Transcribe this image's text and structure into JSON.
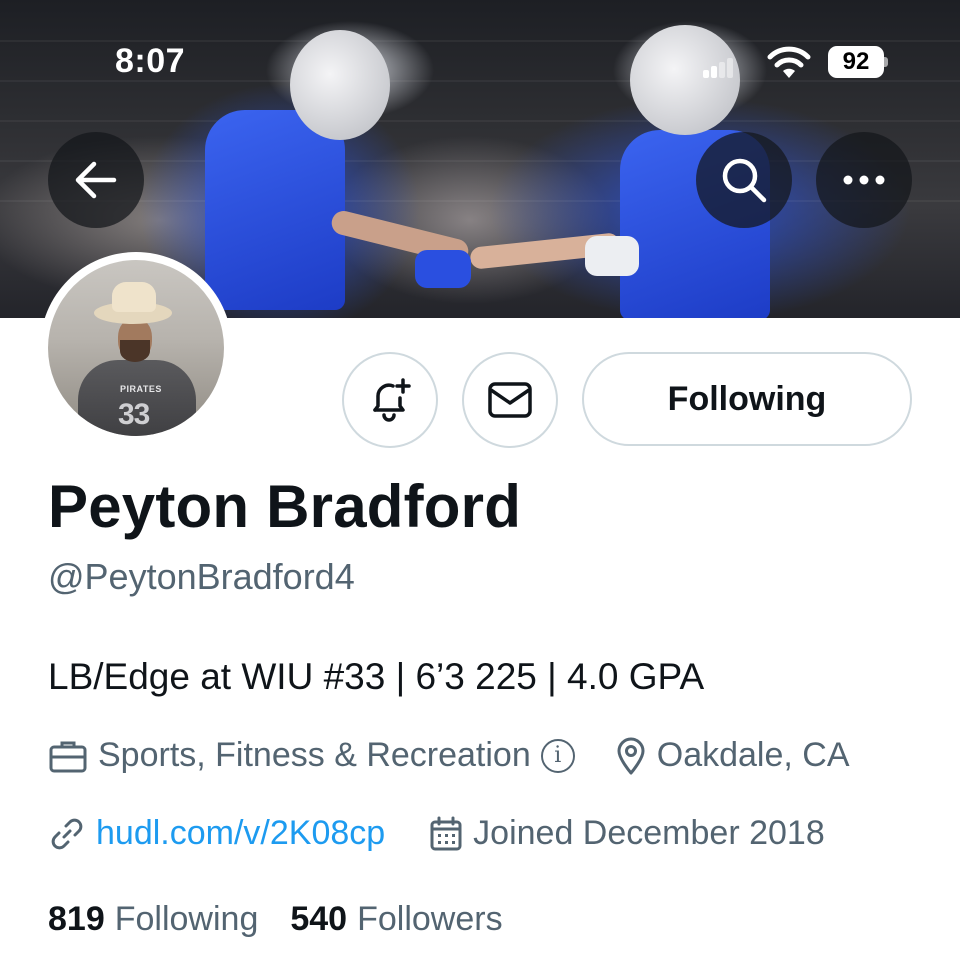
{
  "status_bar": {
    "time": "8:07",
    "battery": "92",
    "icons": [
      "cellular-signal-icon",
      "wifi-icon",
      "battery-icon"
    ]
  },
  "nav": {
    "back_icon": "arrow-left-icon",
    "search_icon": "search-icon",
    "more_icon": "more-horizontal-icon"
  },
  "profile": {
    "name": "Peyton Bradford",
    "handle": "@PeytonBradford4",
    "bio": "LB/Edge at WIU #33 | 6’3 225 | 4.0 GPA",
    "category": "Sports, Fitness & Recreation",
    "location": "Oakdale, CA",
    "website": "hudl.com/v/2K08cp",
    "joined": "Joined December 2018",
    "avatar_jersey_number": "33",
    "avatar_team_text": "PIRATES"
  },
  "actions": {
    "notify_icon": "bell-plus-icon",
    "message_icon": "envelope-icon",
    "following_label": "Following"
  },
  "stats": {
    "following_count": "819",
    "following_label": "Following",
    "followers_count": "540",
    "followers_label": "Followers"
  },
  "colors": {
    "text_primary": "#0f1419",
    "text_secondary": "#536471",
    "link": "#1d9bf0",
    "border": "#cfd9de",
    "jersey_blue": "#2a4fe0"
  }
}
